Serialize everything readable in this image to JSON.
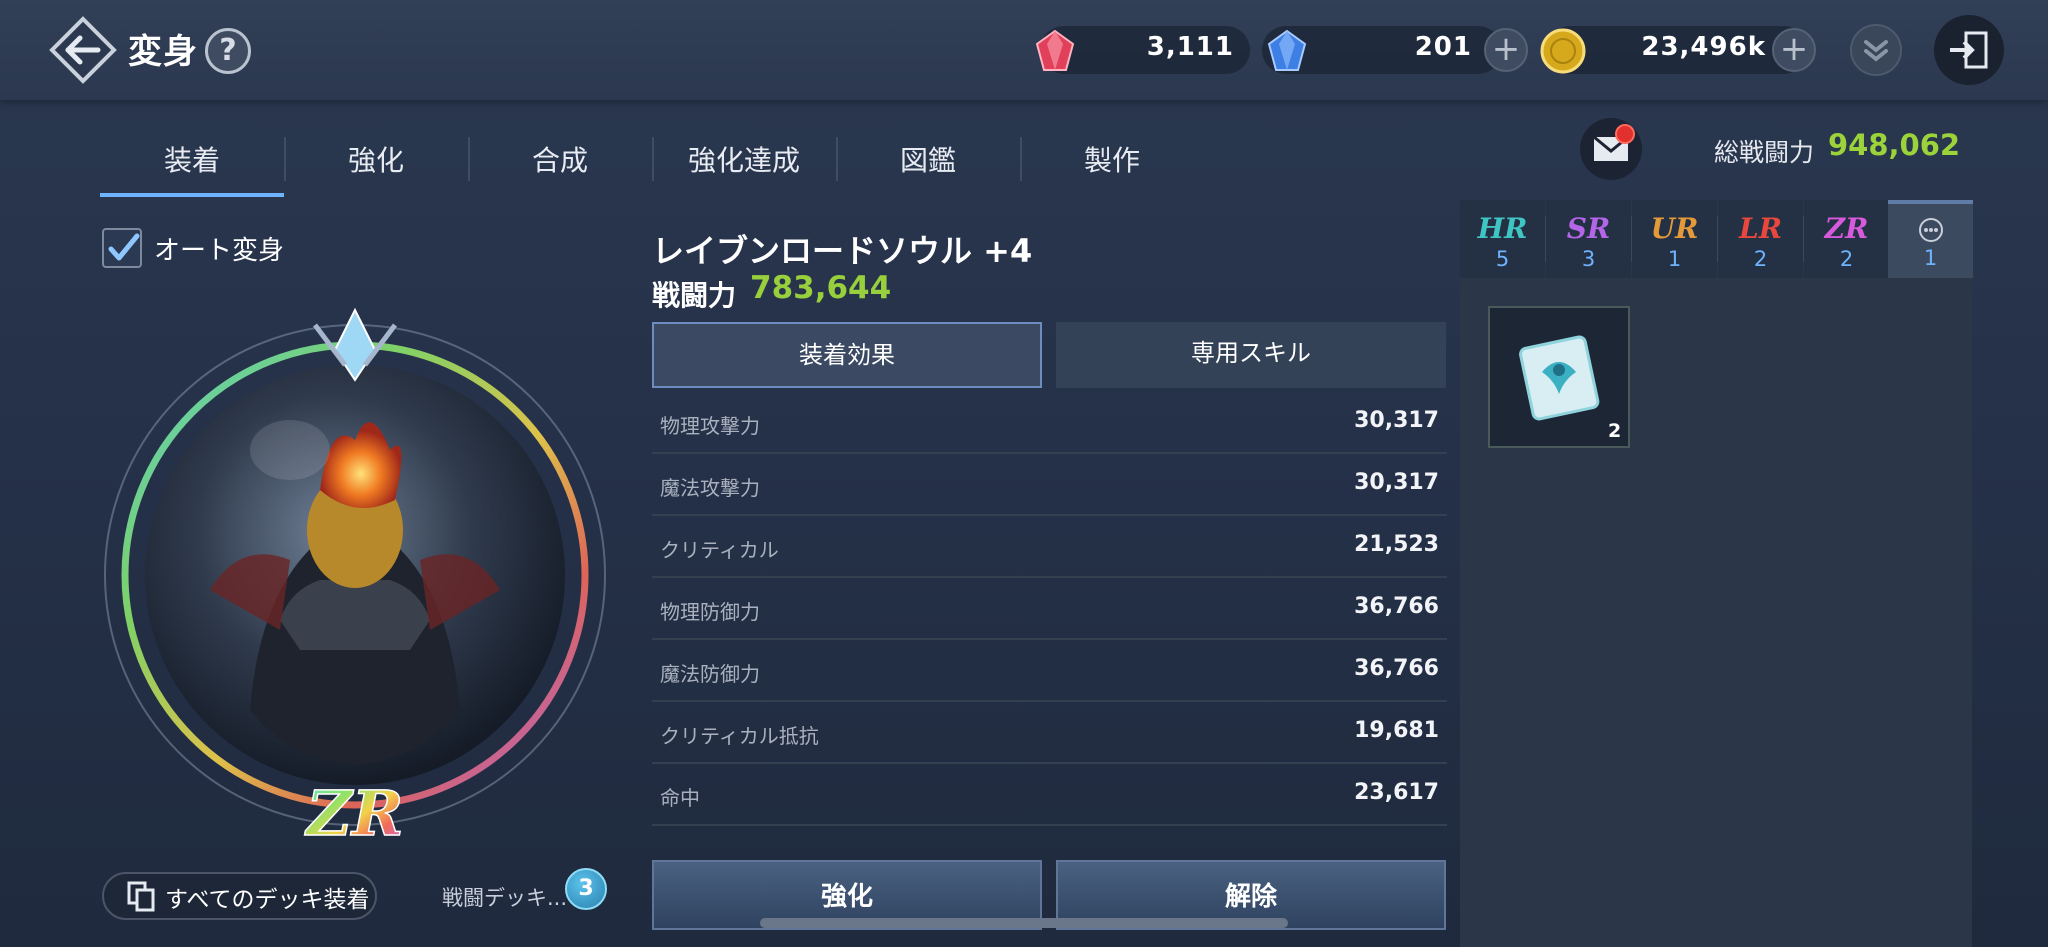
{
  "header": {
    "title": "変身",
    "help": "?",
    "currencies": {
      "red_gem": "3,111",
      "blue_gem": "201",
      "gold": "23,496k"
    }
  },
  "tabs": [
    "装着",
    "強化",
    "合成",
    "強化達成",
    "図鑑",
    "製作"
  ],
  "total_power": {
    "label": "総戦闘力",
    "value": "948,062"
  },
  "left": {
    "auto_transform_label": "オート変身",
    "auto_transform_checked": true,
    "grade_emblem": "ZR",
    "equip_all_deck_label": "すべてのデッキ装着",
    "battle_deck_label": "戦闘デッキ...",
    "battle_deck_number": "3"
  },
  "character": {
    "name": "レイブンロードソウル +4",
    "power_label": "戦闘力",
    "power_value": "783,644"
  },
  "subtabs": [
    "装着効果",
    "専用スキル"
  ],
  "stats": [
    {
      "name": "物理攻撃力",
      "value": "30,317"
    },
    {
      "name": "魔法攻撃力",
      "value": "30,317"
    },
    {
      "name": "クリティカル",
      "value": "21,523"
    },
    {
      "name": "物理防御力",
      "value": "36,766"
    },
    {
      "name": "魔法防御力",
      "value": "36,766"
    },
    {
      "name": "クリティカル抵抗",
      "value": "19,681"
    },
    {
      "name": "命中",
      "value": "23,617"
    }
  ],
  "actions": {
    "enhance": "強化",
    "release": "解除"
  },
  "grade_tabs": [
    {
      "grade": "HR",
      "count": "5",
      "color": "#3fc6c2"
    },
    {
      "grade": "SR",
      "count": "3",
      "color": "#b566e8"
    },
    {
      "grade": "UR",
      "count": "1",
      "color": "#e59a3a"
    },
    {
      "grade": "LR",
      "count": "2",
      "color": "#e8473e"
    },
    {
      "grade": "ZR",
      "count": "2",
      "color": "#d65adb"
    },
    {
      "grade": "...",
      "count": "1",
      "color": "#c8cfda"
    }
  ],
  "inventory": [
    {
      "icon": "scroll-icon",
      "count": "2"
    }
  ],
  "colors": {
    "accent_green": "#9cd33a",
    "tab_underline": "#6fb2ff",
    "count_blue": "#6fb3ff"
  }
}
